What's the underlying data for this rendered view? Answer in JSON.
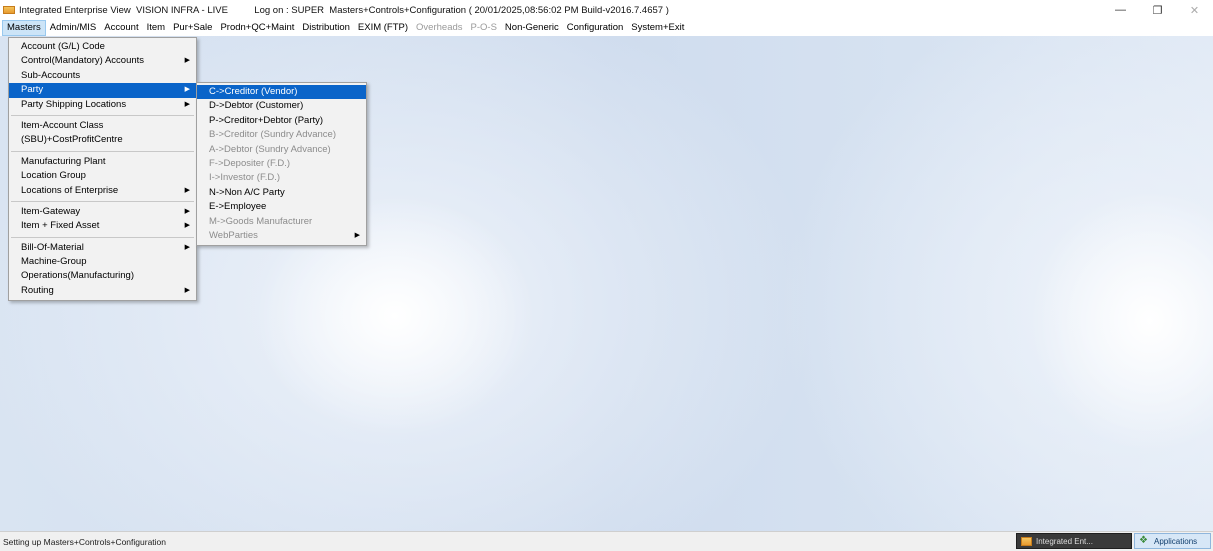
{
  "titlebar": {
    "text": "Integrated Enterprise View  VISION INFRA - LIVE          Log on : SUPER  Masters+Controls+Configuration ( 20/01/2025,08:56:02 PM Build-v2016.7.4657 )",
    "minimize": "—",
    "maximize": "❐",
    "close": "✕"
  },
  "menubar": [
    {
      "label": "Masters",
      "active": true
    },
    {
      "label": "Admin/MIS"
    },
    {
      "label": "Account"
    },
    {
      "label": "Item"
    },
    {
      "label": "Pur+Sale"
    },
    {
      "label": "Prodn+QC+Maint"
    },
    {
      "label": "Distribution"
    },
    {
      "label": "EXIM (FTP)"
    },
    {
      "label": "Overheads",
      "disabled": true
    },
    {
      "label": "P-O-S",
      "disabled": true
    },
    {
      "label": "Non-Generic"
    },
    {
      "label": "Configuration"
    },
    {
      "label": "System+Exit"
    }
  ],
  "masters_menu": {
    "groups": [
      [
        {
          "label": "Account (G/L) Code"
        },
        {
          "label": "Control(Mandatory) Accounts",
          "submenu": true
        },
        {
          "label": "Sub-Accounts"
        },
        {
          "label": "Party",
          "submenu": true,
          "highlight": true
        },
        {
          "label": "Party Shipping Locations",
          "submenu": true
        }
      ],
      [
        {
          "label": "Item-Account Class"
        },
        {
          "label": "(SBU)+CostProfitCentre"
        }
      ],
      [
        {
          "label": "Manufacturing Plant"
        },
        {
          "label": "Location Group"
        },
        {
          "label": "Locations of Enterprise",
          "submenu": true
        }
      ],
      [
        {
          "label": "Item-Gateway",
          "submenu": true
        },
        {
          "label": "Item + Fixed Asset",
          "submenu": true
        }
      ],
      [
        {
          "label": "Bill-Of-Material",
          "submenu": true
        },
        {
          "label": "Machine-Group"
        },
        {
          "label": "Operations(Manufacturing)"
        },
        {
          "label": "Routing",
          "submenu": true
        }
      ]
    ]
  },
  "party_menu": {
    "items": [
      {
        "label": "C->Creditor (Vendor)",
        "highlight": true
      },
      {
        "label": "D->Debtor (Customer)"
      },
      {
        "label": "P->Creditor+Debtor (Party)"
      },
      {
        "label": "B->Creditor (Sundry Advance)",
        "disabled": true
      },
      {
        "label": "A->Debtor (Sundry Advance)",
        "disabled": true
      },
      {
        "label": "F->Depositer (F.D.)",
        "disabled": true
      },
      {
        "label": "I->Investor (F.D.)",
        "disabled": true
      },
      {
        "label": "N->Non A/C Party"
      },
      {
        "label": "E->Employee"
      },
      {
        "label": "M->Goods Manufacturer",
        "disabled": true
      },
      {
        "label": "WebParties",
        "disabled": true,
        "submenu": true
      }
    ]
  },
  "statusbar": {
    "text": "Setting up Masters+Controls+Configuration"
  },
  "taskbar": {
    "task1": "Integrated Ent...",
    "task2": "Applications"
  },
  "colors": {
    "menu_highlight": "#0a64c9",
    "menubar_active": "#cce4f7"
  }
}
